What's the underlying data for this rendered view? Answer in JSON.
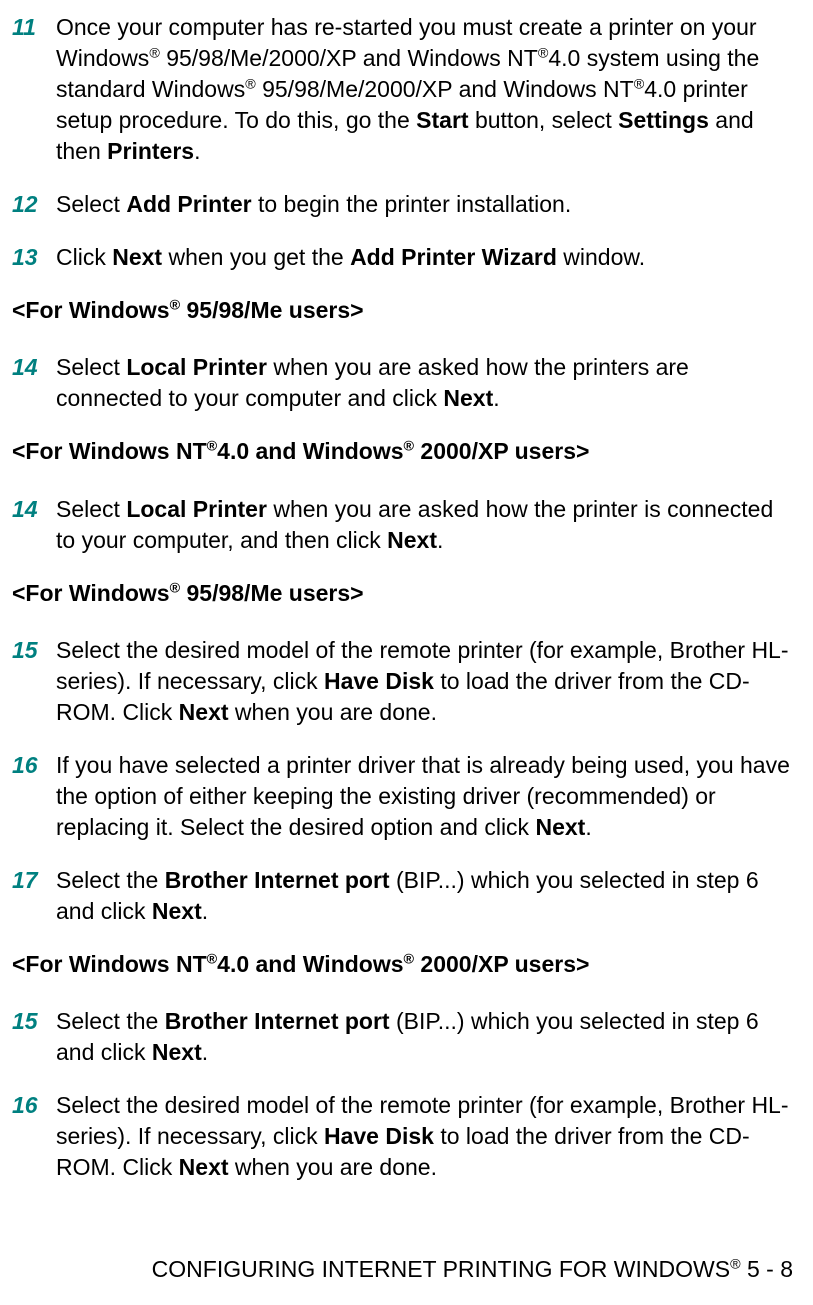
{
  "steps_a": [
    {
      "num": "11",
      "html": "Once your computer has re-started you must create a printer on your Windows<sup>®</sup> 95/98/Me/2000/XP and Windows NT<sup>®</sup>4.0 system using the standard Windows<sup>®</sup> 95/98/Me/2000/XP and Windows NT<sup>®</sup>4.0 printer setup procedure. To do this, go the <span class='b'>Start</span> button, select <span class='b'>Settings</span> and then <span class='b'>Printers</span>."
    },
    {
      "num": "12",
      "html": "Select <span class='b'>Add Printer</span> to begin the printer installation."
    },
    {
      "num": "13",
      "html": "Click <span class='b'>Next</span> when you get the <span class='b'>Add Printer Wizard</span> window."
    }
  ],
  "heading_b": "&lt;For Windows<sup>®</sup> 95/98/Me users&gt;",
  "steps_b": [
    {
      "num": "14",
      "html": "Select <span class='b'>Local Printer</span> when you are asked how the printers are connected to your computer and click <span class='b'>Next</span>."
    }
  ],
  "heading_c": "&lt;For Windows NT<sup>®</sup>4.0 and Windows<sup>®</sup> 2000/XP users&gt;",
  "steps_c": [
    {
      "num": "14",
      "html": "Select <span class='b'>Local Printer</span> when you are asked how the printer is connected to your computer, and then click <span class='b'>Next</span>."
    }
  ],
  "heading_d": "&lt;For Windows<sup>®</sup> 95/98/Me users&gt;",
  "steps_d": [
    {
      "num": "15",
      "html": "Select the desired model of the remote printer (for example, Brother HL-series). If necessary, click <span class='b'>Have Disk</span> to load the driver from the CD-ROM. Click <span class='b'>Next</span> when you are done."
    },
    {
      "num": "16",
      "html": "If you have selected a printer driver that is already being used, you have the option of either keeping the existing driver (recommended) or replacing it. Select the desired option and click <span class='b'>Next</span>."
    },
    {
      "num": "17",
      "html": "Select the <span class='b'>Brother Internet port</span> (BIP...) which you selected in step 6 and click <span class='b'>Next</span>."
    }
  ],
  "heading_e": "&lt;For Windows NT<sup>®</sup>4.0 and Windows<sup>®</sup> 2000/XP users&gt;",
  "steps_e": [
    {
      "num": "15",
      "html": "Select the <span class='b'>Brother Internet port</span> (BIP...) which you selected in step 6 and click <span class='b'>Next</span>."
    },
    {
      "num": "16",
      "html": "Select the desired model of the remote printer (for example, Brother HL-series). If necessary, click <span class='b'>Have Disk</span> to load the driver from the CD-ROM. Click <span class='b'>Next</span> when you are done."
    }
  ],
  "footer": "CONFIGURING INTERNET PRINTING FOR WINDOWS<sup>®</sup> 5 - 8"
}
